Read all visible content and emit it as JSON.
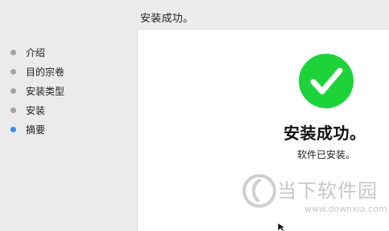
{
  "header": {
    "stage_title": "安装成功。"
  },
  "sidebar": {
    "steps": [
      {
        "label": "介绍",
        "state": "done"
      },
      {
        "label": "目的宗卷",
        "state": "done"
      },
      {
        "label": "安装类型",
        "state": "done"
      },
      {
        "label": "安装",
        "state": "done"
      },
      {
        "label": "摘要",
        "state": "current"
      }
    ]
  },
  "main": {
    "status_icon": "checkmark-icon",
    "title": "安装成功。",
    "subtitle": "软件已安装。"
  },
  "watermark": {
    "name": "当下软件园",
    "url": "www.downxia.com"
  },
  "colors": {
    "success_green": "#1ed33a",
    "active_step_dot": "#3a8ee6",
    "inactive_step_dot": "#a3a3a3"
  }
}
